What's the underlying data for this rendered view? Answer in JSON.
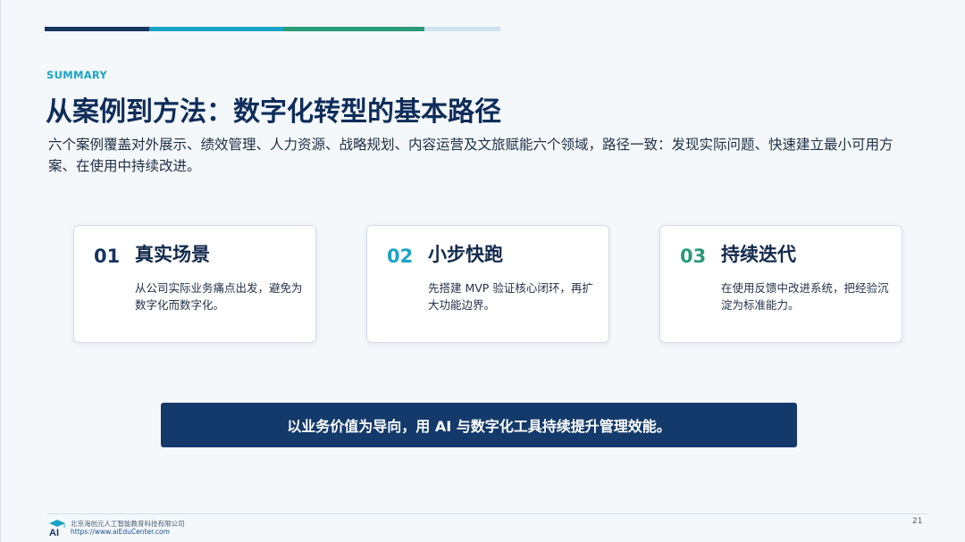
{
  "header": {
    "kicker": "SUMMARY",
    "title": "从案例到方法：数字化转型的基本路径",
    "intro": "六个案例覆盖对外展示、绩效管理、人力资源、战略规划、内容运营及文旅赋能六个领域，路径一致：发现实际问题、快速建立最小可用方案、在使用中持续改进。"
  },
  "cards": [
    {
      "num": "01",
      "title": "真实场景",
      "body": "从公司实际业务痛点出发，避免为数字化而数字化。"
    },
    {
      "num": "02",
      "title": "小步快跑",
      "body": "先搭建 MVP 验证核心闭环，再扩大功能边界。"
    },
    {
      "num": "03",
      "title": "持续迭代",
      "body": "在使用反馈中改进系统，把经验沉淀为标准能力。"
    }
  ],
  "banner": "以业务价值为导向，用 AI 与数字化工具持续提升管理效能。",
  "footer": {
    "org": "北京海创元人工智能教育科技有限公司",
    "url": "https://www.aiEduCenter.com",
    "page": "21",
    "logo_text": "AI"
  },
  "colors": {
    "navy": "#17355f",
    "cyan": "#1aa3c8",
    "green": "#2a9a77",
    "light": "#cfe2ee",
    "banner": "#143a6b"
  }
}
